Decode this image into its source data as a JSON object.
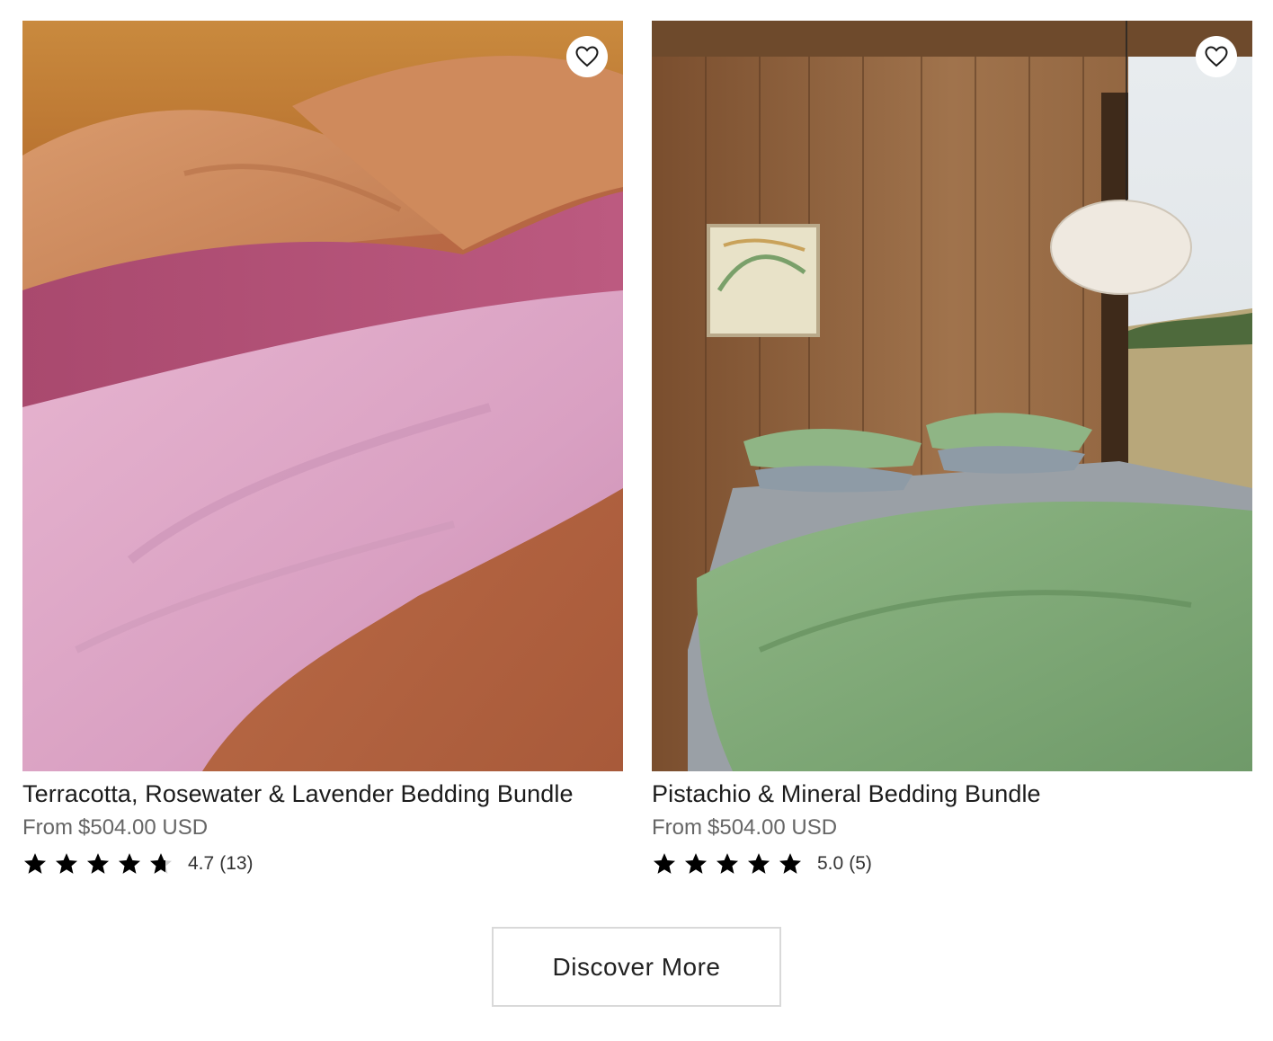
{
  "products": [
    {
      "title": "Terracotta, Rosewater & Lavender Bedding Bundle",
      "price_prefix": "From",
      "price": "$504.00 USD",
      "rating": "4.7",
      "review_count": "(13)",
      "stars_filled": 4.7,
      "image_icon": "bedding-photo-terracotta"
    },
    {
      "title": "Pistachio & Mineral Bedding Bundle",
      "price_prefix": "From",
      "price": "$504.00 USD",
      "rating": "5.0",
      "review_count": "(5)",
      "stars_filled": 5,
      "image_icon": "bedding-photo-pistachio"
    }
  ],
  "discover_button": {
    "label": "Discover More"
  },
  "icons": {
    "wishlist": "heart-outline-icon",
    "star": "star-icon"
  },
  "colors": {
    "star": "#000000",
    "price_text": "#666666",
    "button_border": "#d9d9d9"
  }
}
